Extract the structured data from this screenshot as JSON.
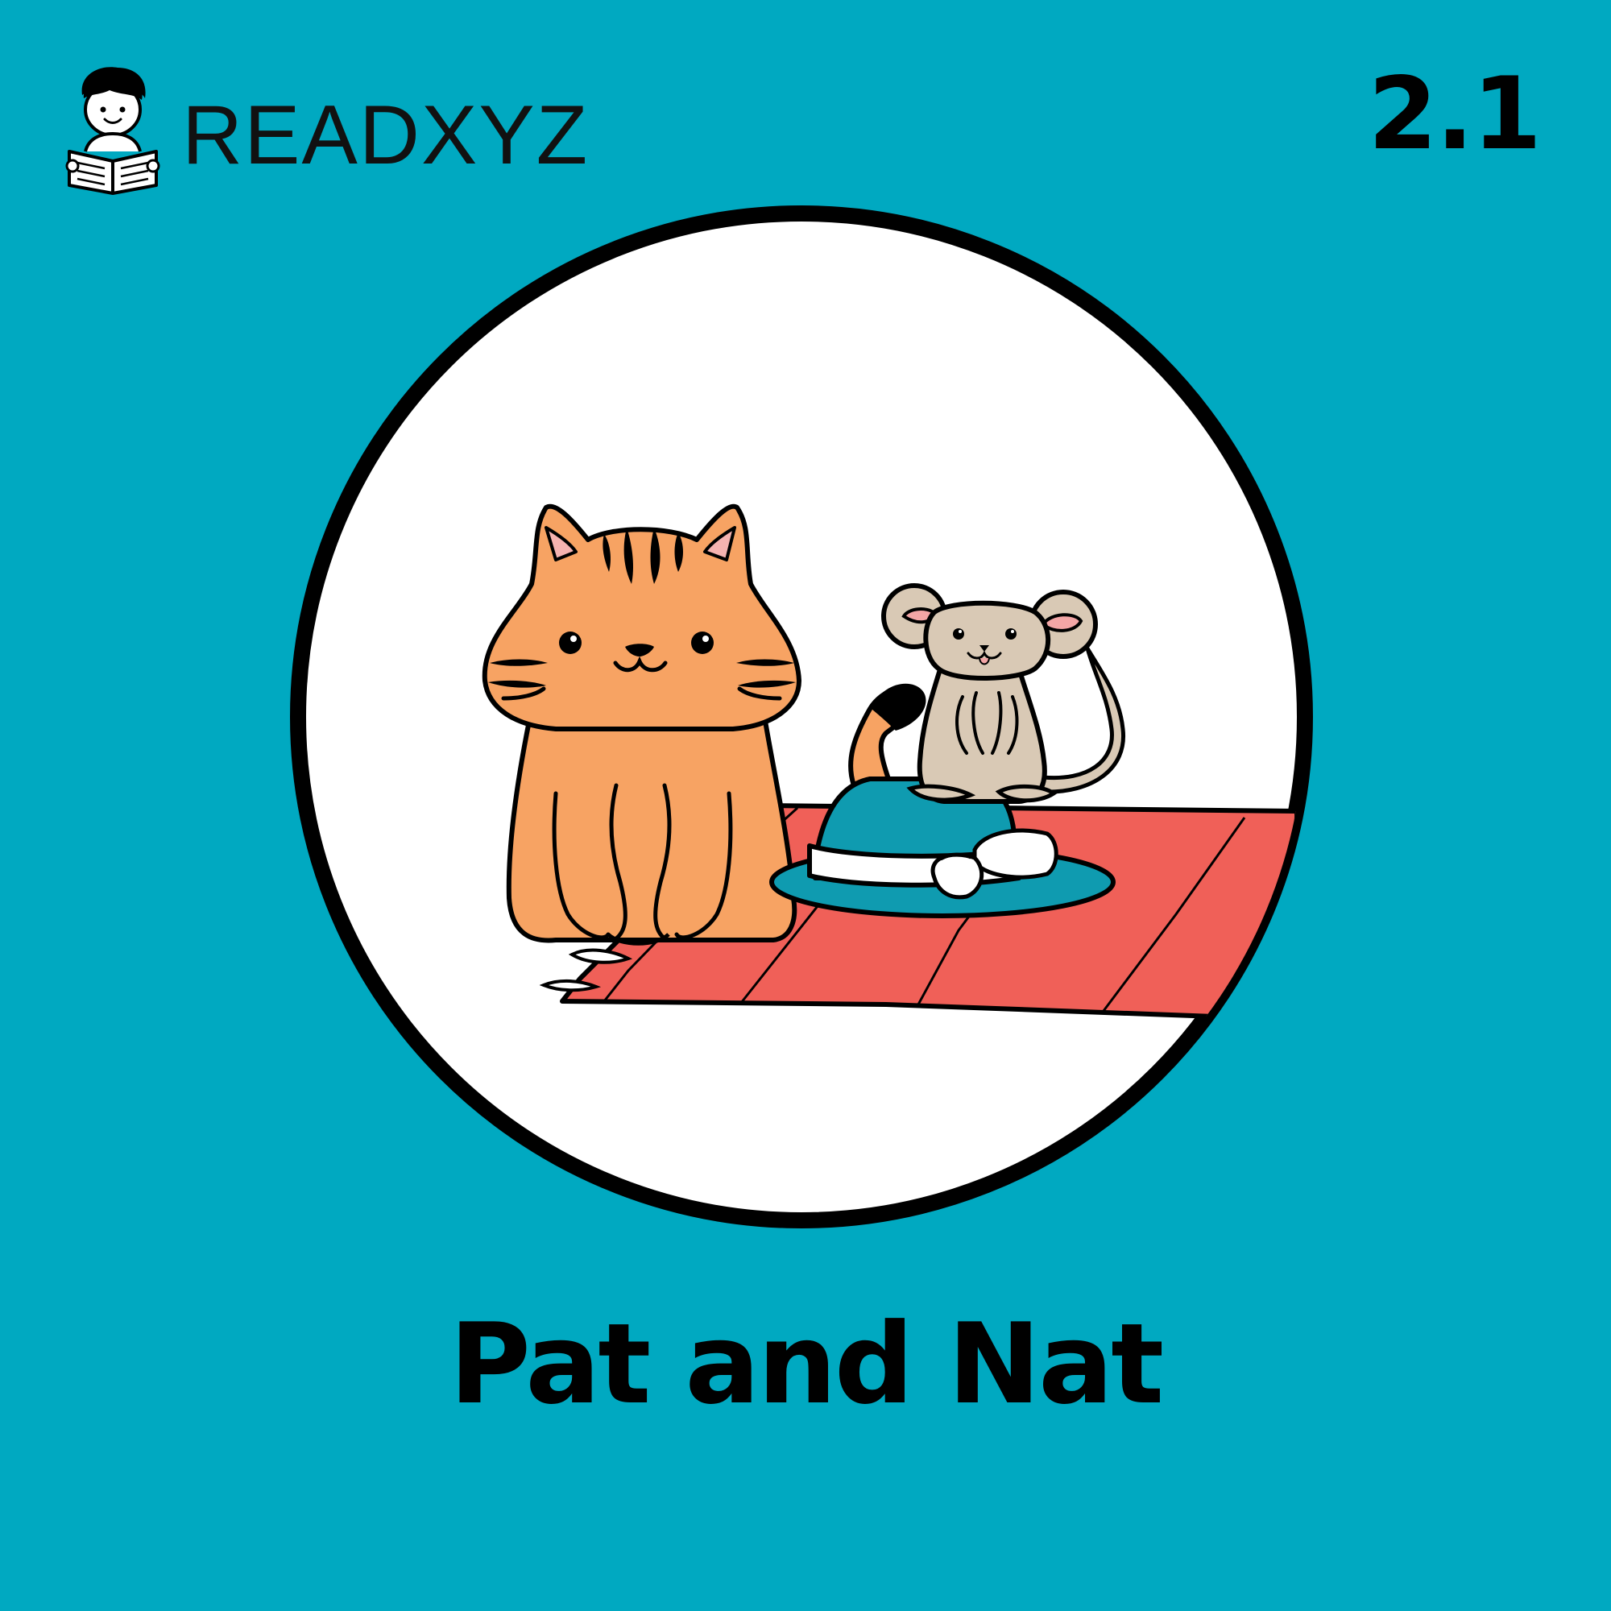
{
  "brand": {
    "name": "READXYZ",
    "logo_icon": "child-reading-book-icon"
  },
  "level": "2.1",
  "title": "Pat and Nat",
  "illustration": {
    "subjects": [
      "cat-icon",
      "mouse-icon",
      "hat-icon",
      "blanket-icon"
    ]
  },
  "colors": {
    "background": "#00A9C1",
    "circle_fill": "#FFFFFF",
    "circle_border": "#000000",
    "cat_fur": "#F7A363",
    "cat_ear_inner": "#F5B3B0",
    "mouse_fur": "#D9C9B5",
    "mouse_ear_inner": "#F3A6A6",
    "blanket": "#F06058",
    "hat": "#0F9BB0",
    "hat_band": "#FFFFFF",
    "ink": "#000000"
  }
}
